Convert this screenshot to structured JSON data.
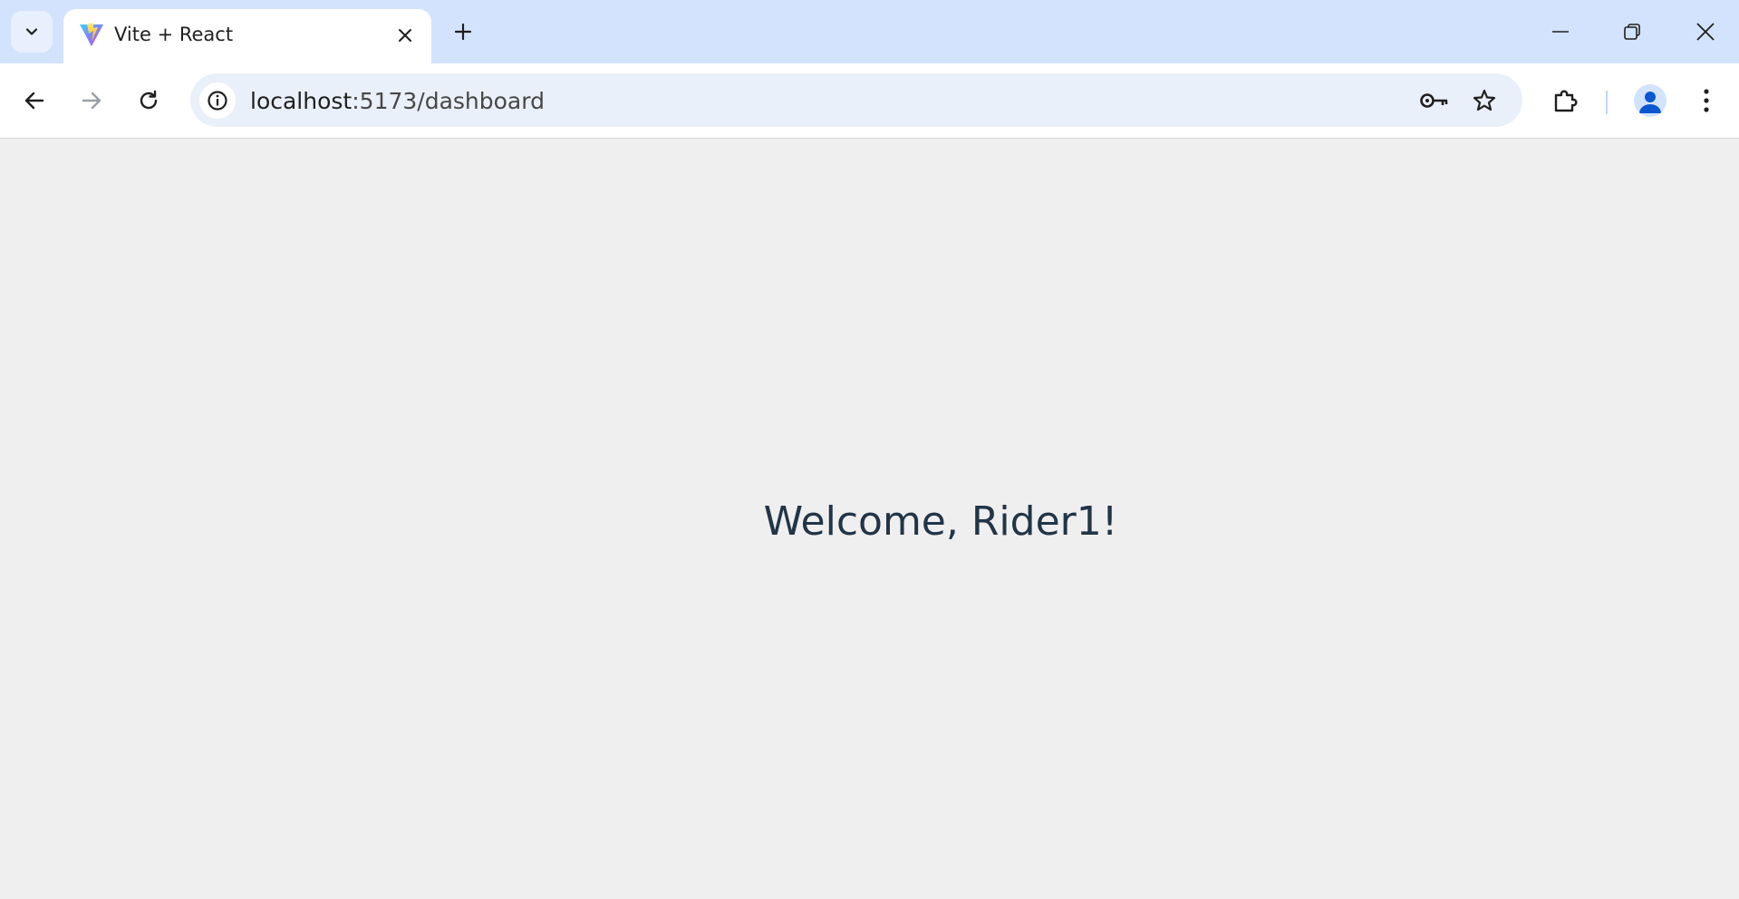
{
  "browser": {
    "tab": {
      "title": "Vite + React",
      "favicon": "vite-logo-icon"
    },
    "address_bar": {
      "host": "localhost",
      "path": ":5173/dashboard"
    },
    "icons": {
      "tab_search": "chevron-down-icon",
      "tab_close": "close-icon",
      "new_tab": "plus-icon",
      "minimize": "minimize-icon",
      "restore": "restore-icon",
      "close_window": "close-icon",
      "back": "arrow-left-icon",
      "forward": "arrow-right-icon",
      "reload": "reload-icon",
      "site_info": "info-icon",
      "passwords": "key-icon",
      "bookmark": "star-icon",
      "extensions": "puzzle-icon",
      "profile": "person-icon",
      "menu": "more-vertical-icon"
    },
    "colors": {
      "tabstrip": "#d3e3fd",
      "omnibox": "#eaf0f9",
      "page_background": "#efefef",
      "text": "#213547"
    }
  },
  "page": {
    "welcome_text": "Welcome, Rider1!"
  }
}
